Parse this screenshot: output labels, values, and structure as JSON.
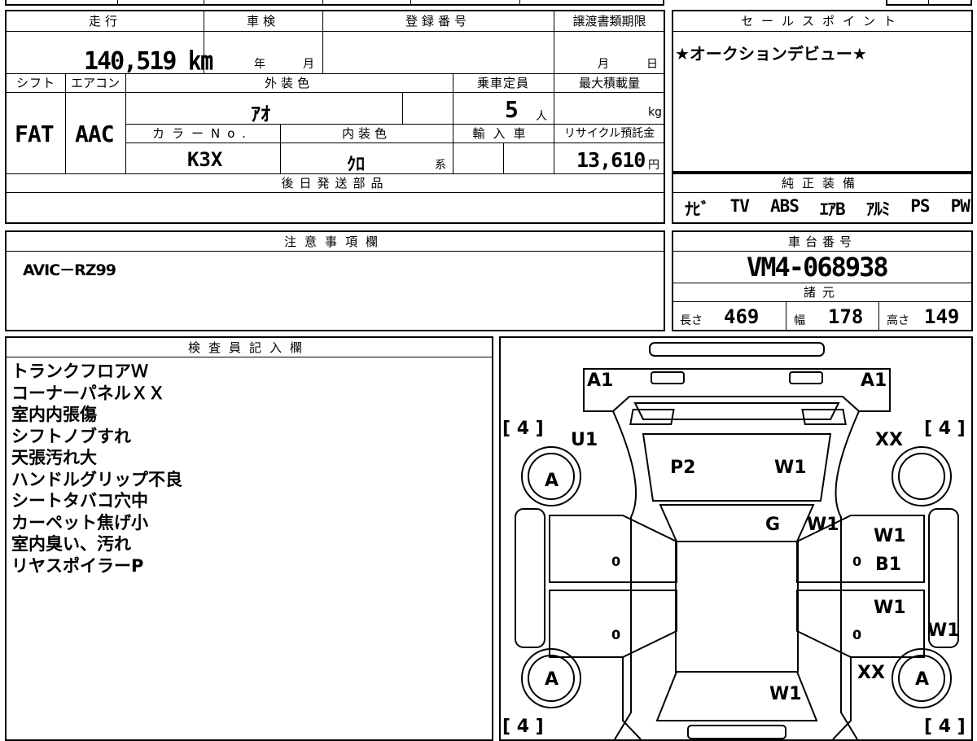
{
  "main": {
    "headers": {
      "mileage": "走行",
      "inspection": "車検",
      "registration": "登録番号",
      "transfer_deadline": "譲渡書類期限",
      "shift": "シフト",
      "aircon": "エアコン",
      "exterior_color": "外装色",
      "capacity": "乗車定員",
      "max_load": "最大積載量",
      "color_no": "カラーNo.",
      "interior_color": "内装色",
      "import": "輸入車",
      "recycle": "リサイクル預託金",
      "later_parts": "後日発送部品"
    },
    "values": {
      "mileage": "140,519 ㎞",
      "year_unit": "年",
      "month_unit": "月",
      "deadline_month": "月",
      "deadline_day": "日",
      "shift": "FAT",
      "aircon": "AAC",
      "exterior_color": "ｱｵ",
      "capacity": "5",
      "capacity_unit": "人",
      "max_load_unit": "kg",
      "color_no": "K3X",
      "interior_color": "ｸﾛ",
      "interior_suffix": "系",
      "recycle": "13,610",
      "recycle_unit": "円"
    }
  },
  "sales": {
    "header": "セールスポイント",
    "text": "★オークションデビュー★"
  },
  "equipment": {
    "header": "純正装備",
    "items": [
      "ﾅﾋﾞ",
      "TV",
      "ABS",
      "ｴｱB",
      "ｱﾙﾐ",
      "PS",
      "PW"
    ]
  },
  "notes": {
    "header": "注意事項欄",
    "text": "AVIC－RZ99"
  },
  "chassis": {
    "header": "車台番号",
    "number": "VM4-068938",
    "specs_header": "諸元",
    "length_label": "長さ",
    "length": "469",
    "width_label": "幅",
    "width": "178",
    "height_label": "高さ",
    "height": "149"
  },
  "inspector": {
    "header": "検査員記入欄",
    "lines": [
      "トランクフロアＷ",
      "コーナーパネルＸＸ",
      "室内内張傷",
      "シフトノブすれ",
      "天張汚れ大",
      "ハンドルグリップ不良",
      "シートタバコ穴中",
      "カーペット焦げ小",
      "室内臭い、汚れ",
      "リヤスポイラーP"
    ]
  },
  "diagram": {
    "marks": {
      "a1_left": "A1",
      "a1_right": "A1",
      "u1": "U1",
      "xx_top": "XX",
      "p2": "P2",
      "w1_roof": "W1",
      "g": "G",
      "w1_windshield": "W1",
      "w1_right_door1": "W1",
      "b1": "B1",
      "w1_right_door2": "W1",
      "w1_side": "W1",
      "xx_bottom": "XX",
      "w1_bottom": "W1",
      "tire_tl": "A",
      "tire_tr": "",
      "tire_bl": "A",
      "tire_br": "A"
    },
    "tire_labels": {
      "tl": "[ 4 ]",
      "tr": "[ 4 ]",
      "bl": "[ 4 ]",
      "br": "[ 4 ]"
    },
    "zeros": [
      "0",
      "0",
      "0",
      "0"
    ]
  }
}
